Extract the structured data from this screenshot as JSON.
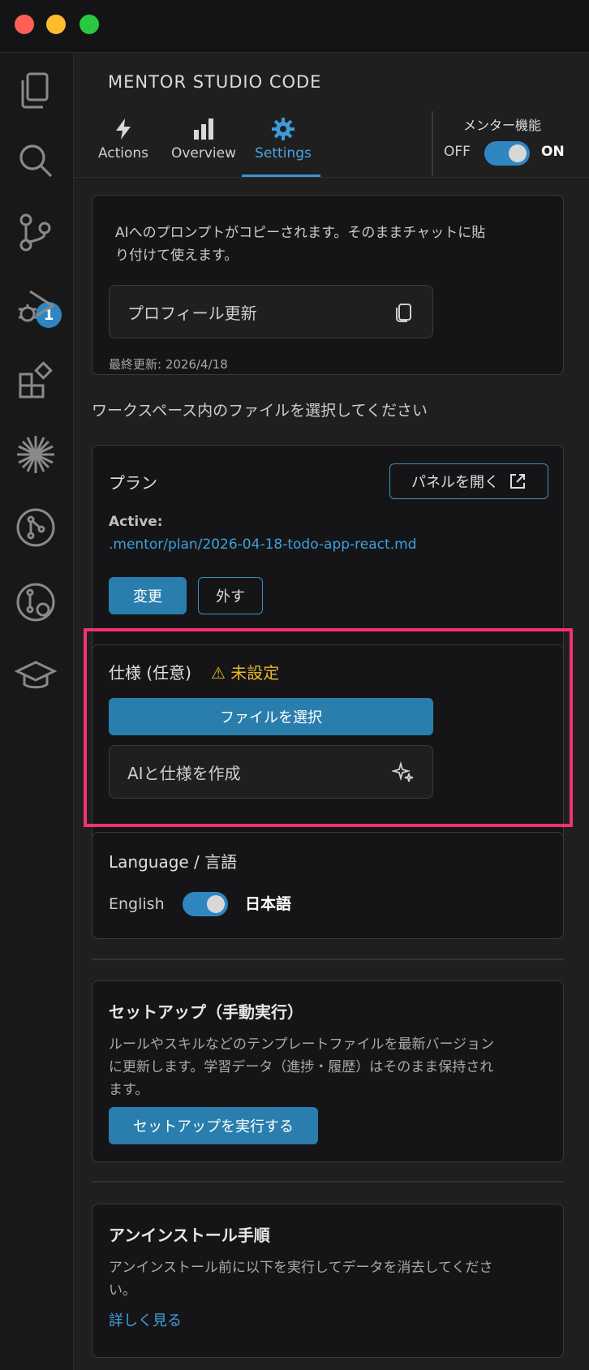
{
  "window": {
    "title": "MENTOR STUDIO CODE"
  },
  "activity_bar": {
    "icons": [
      "files-icon",
      "search-icon",
      "source-control-icon",
      "run-debug-icon",
      "extensions-icon",
      "spark-icon",
      "git-graph-icon",
      "git-lens-icon",
      "mentor-cap-icon"
    ],
    "source_control_badge": "1"
  },
  "tabs": [
    {
      "label": "Actions",
      "icon": "bolt-icon"
    },
    {
      "label": "Overview",
      "icon": "bar-chart-icon"
    },
    {
      "label": "Settings",
      "icon": "gear-icon",
      "active": true
    }
  ],
  "mentor_toggle": {
    "label": "メンター機能",
    "off": "OFF",
    "on": "ON",
    "state": "on"
  },
  "prompt_card": {
    "description_line1": "AIへのプロンプトがコピーされます。そのままチャットに貼",
    "description_line2": "り付けて使えます。",
    "profile_button": "プロフィール更新",
    "last_updated": "最終更新: 2026/4/18"
  },
  "workspace_hint": "ワークスペース内のファイルを選択してください",
  "plan_card": {
    "title": "プラン",
    "open_panel": "パネルを開く",
    "active_label": "Active:",
    "active_path": ".mentor/plan/2026-04-18-todo-app-react.md",
    "change_button": "変更",
    "remove_button": "外す"
  },
  "spec_card": {
    "title": "仕様 (任意)",
    "status": "⚠ 未設定",
    "select_file": "ファイルを選択",
    "ai_create": "AIと仕様を作成"
  },
  "language_card": {
    "title": "Language / 言語",
    "english": "English",
    "japanese": "日本語",
    "state": "japanese"
  },
  "setup_card": {
    "title": "セットアップ（手動実行）",
    "line1": "ルールやスキルなどのテンプレートファイルを最新バージョン",
    "line2": "に更新します。学習データ（進捗・履歴）はそのまま保持され",
    "line3": "ます。",
    "button": "セットアップを実行する"
  },
  "uninstall_card": {
    "title": "アンインストール手順",
    "line1": "アンインストール前に以下を実行してデータを消去してくださ",
    "line2": "い。",
    "link": "詳しく見る"
  },
  "colors": {
    "accent": "#2a7ead",
    "link": "#3ea0dc",
    "warning": "#e8b52b",
    "highlight": "#f1336b"
  }
}
